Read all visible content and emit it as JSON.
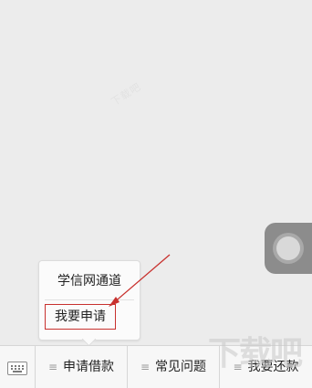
{
  "popup": {
    "items": [
      "学信网通道",
      "我要申请"
    ]
  },
  "menu": {
    "tabs": [
      {
        "label": "申请借款"
      },
      {
        "label": "常见问题"
      },
      {
        "label": "我要还款"
      }
    ],
    "lines_glyph": "≡"
  },
  "watermarks": {
    "background_text": "下载吧",
    "site_logo_text": "下载吧"
  },
  "colors": {
    "annotation_red": "#c8312e",
    "background": "#ececec",
    "menubar": "#f7f7f7"
  },
  "icons": {
    "keyboard": "keyboard-icon",
    "assistive_touch": "assistive-touch-icon",
    "annotation_arrow": "arrow-icon"
  }
}
